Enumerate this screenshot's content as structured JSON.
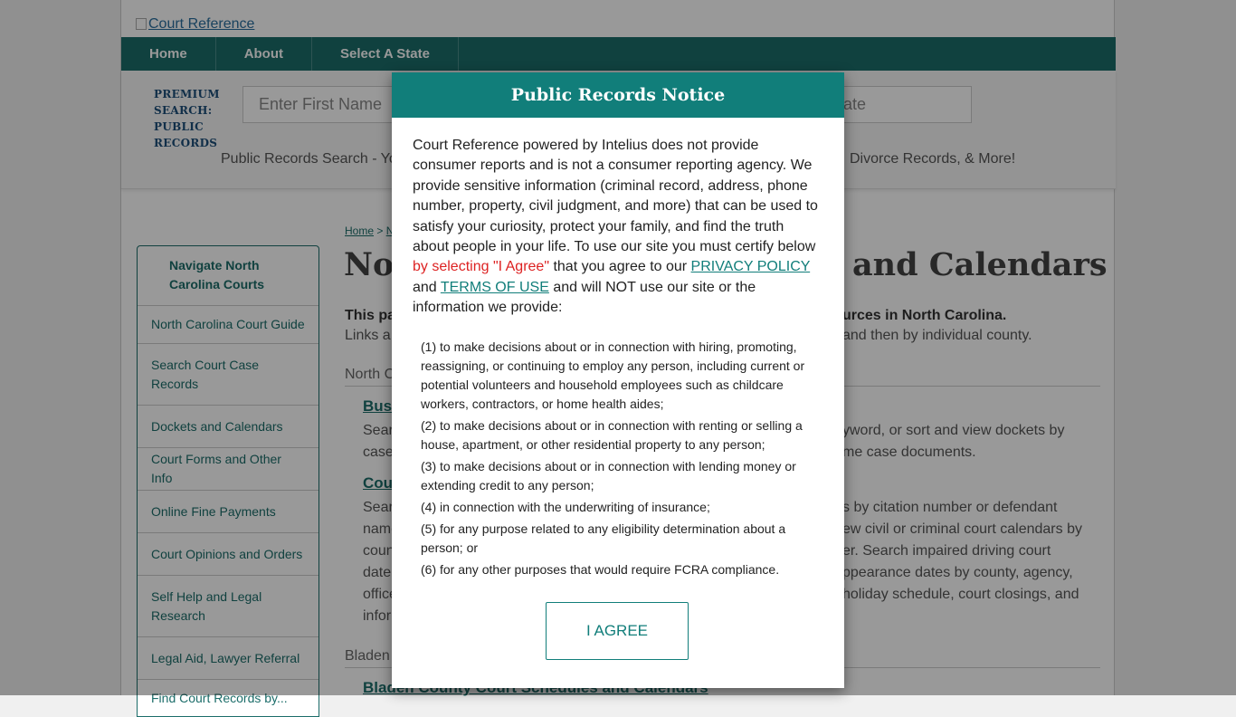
{
  "logo": {
    "alt_text": "Court Reference"
  },
  "nav": {
    "home": "Home",
    "about": "About",
    "select_state": "Select A State"
  },
  "search": {
    "premium_label": "PREMIUM SEARCH: PUBLIC RECORDS",
    "first_name_placeholder": "Enter First Name",
    "state_placeholder": "ate",
    "tagline_left": "Public Records Search - Yo",
    "tagline_right": "Divorce Records, & More!"
  },
  "sidebar": {
    "header": "Navigate North Carolina Courts",
    "items": [
      "North Carolina Court Guide",
      "Search Court Case Records",
      "Dockets and Calendars",
      "Court Forms and Other Info",
      "Online Fine Payments",
      "Court Opinions and Orders",
      "Self Help and Legal Research",
      "Legal Aid, Lawyer Referral",
      "Find Court Records by..."
    ]
  },
  "main": {
    "breadcrumb": {
      "home": "Home",
      "sep": " > ",
      "next": "N"
    },
    "title_left": "No",
    "title_right": "and Calendars",
    "lead_left": "This pa",
    "lead_right": "urces in North Carolina.",
    "sub_left": "Links a",
    "sub_right": "and then by individual county.",
    "section1": "North C",
    "link1": "Bus",
    "p1_lines": [
      "Sear",
      "case"
    ],
    "p1_right": [
      "yword, or sort and view dockets by",
      "me case documents."
    ],
    "link2": "Cou",
    "p2_lines": [
      "Sear",
      "name",
      "coun",
      "date",
      "office",
      "infor"
    ],
    "p2_right": [
      "s by citation number or defendant",
      "ew civil or criminal court calendars by",
      "er. Search impaired driving court",
      "ppearance dates by county, agency,",
      "holiday schedule, court closings, and",
      ""
    ],
    "section2": "Bladen",
    "link3": "Bladen County Court Schedules and Calendars"
  },
  "modal": {
    "title": "Public Records Notice",
    "intro": "Court Reference powered by Intelius does not provide consumer reports and is not a consumer reporting agency. We provide sensitive information (criminal record, address, phone number, property, civil judgment, and more) that can be used to satisfy your curiosity, protect your family, and find the truth about people in your life. To use our site you must certify below ",
    "red_text": "by selecting \"I Agree\"",
    "agree_text": " that you agree to our ",
    "privacy": "PRIVACY POLICY",
    "and": " and ",
    "terms": "TERMS OF USE",
    "tail": " and will NOT use our site or the information we provide:",
    "uses": [
      "(1) to make decisions about or in connection with hiring, promoting, reassigning, or continuing to employ any person, including current or potential volunteers and household employees such as childcare workers, contractors, or home health aides;",
      "(2) to make decisions about or in connection with renting or selling a house, apartment, or other residential property to any person;",
      "(3) to make decisions about or in connection with lending money or extending credit to any person;",
      "(4) in connection with the underwriting of insurance;",
      "(5) for any purpose related to any eligibility determination about a person; or",
      "(6) for any other purposes that would require FCRA compliance."
    ],
    "button": "I AGREE"
  }
}
